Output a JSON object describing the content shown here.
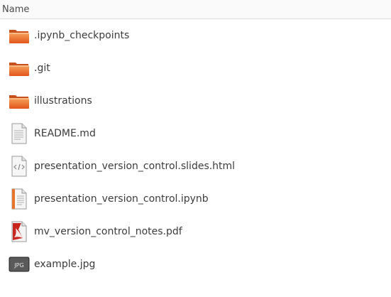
{
  "header": {
    "name_column": "Name"
  },
  "files": [
    {
      "name": ".ipynb_checkpoints",
      "icon": "folder-icon"
    },
    {
      "name": ".git",
      "icon": "folder-icon"
    },
    {
      "name": "illustrations",
      "icon": "folder-icon"
    },
    {
      "name": "README.md",
      "icon": "text-file-icon"
    },
    {
      "name": "presentation_version_control.slides.html",
      "icon": "html-file-icon"
    },
    {
      "name": "presentation_version_control.ipynb",
      "icon": "notebook-file-icon"
    },
    {
      "name": "mv_version_control_notes.pdf",
      "icon": "pdf-file-icon"
    },
    {
      "name": "example.jpg",
      "icon": "image-file-icon",
      "badge": "JPG"
    }
  ]
}
